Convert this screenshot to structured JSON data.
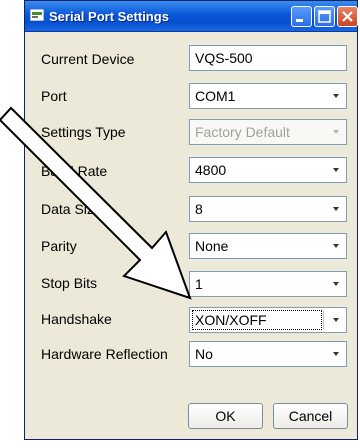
{
  "window": {
    "title": "Serial Port Settings",
    "icon": "serial-port-app-icon",
    "controls": [
      "minimize-icon",
      "maximize-icon",
      "close-icon"
    ]
  },
  "form": {
    "current_device": {
      "label": "Current Device",
      "value": "VQS-500"
    },
    "port": {
      "label": "Port",
      "value": "COM1"
    },
    "settings_type": {
      "label": "Settings Type",
      "value": "Factory Default"
    },
    "baud_rate": {
      "label": "Baud Rate",
      "value": "4800"
    },
    "data_size": {
      "label": "Data Size",
      "value": "8"
    },
    "parity": {
      "label": "Parity",
      "value": "None"
    },
    "stop_bits": {
      "label": "Stop Bits",
      "value": "1"
    },
    "handshake": {
      "label": "Handshake",
      "value": "XON/XOFF"
    },
    "hardware_reflection": {
      "label": "Hardware Reflection",
      "value": "No"
    }
  },
  "buttons": {
    "ok": "OK",
    "cancel": "Cancel"
  },
  "colors": {
    "titlebar": "#0a58d8",
    "dialog_bg": "#ece9d8",
    "field_border": "#7f9db9"
  }
}
